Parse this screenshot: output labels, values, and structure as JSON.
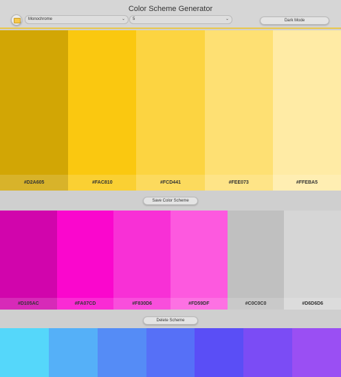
{
  "header": {
    "title": "Color Scheme Generator",
    "scheme_type": "Monochrome",
    "color_count": "5",
    "dark_mode_label": "Dark Mode"
  },
  "actions": {
    "save_label": "Save Color Scheme",
    "delete_label": "Delete Scheme"
  },
  "current_palette": [
    {
      "hex": "#D2A605"
    },
    {
      "hex": "#FAC810"
    },
    {
      "hex": "#FCD441"
    },
    {
      "hex": "#FEE073"
    },
    {
      "hex": "#FFEBA5"
    }
  ],
  "saved_palette_1": [
    {
      "hex": "#D105AC"
    },
    {
      "hex": "#FA07CD"
    },
    {
      "hex": "#F830D6"
    },
    {
      "hex": "#FD59DF"
    },
    {
      "hex": "#C0C0C0"
    },
    {
      "hex": "#D6D6D6"
    }
  ],
  "saved_palette_2": [
    {
      "color": "#55D7FA"
    },
    {
      "color": "#55B0F8"
    },
    {
      "color": "#558CF6"
    },
    {
      "color": "#5670F7"
    },
    {
      "color": "#5A4EF6"
    },
    {
      "color": "#7B4CF5"
    },
    {
      "color": "#9A4FF3"
    }
  ],
  "colors": {
    "header_accent": "#E9C74A",
    "background": "#CFCFCF"
  },
  "icons": {
    "palette_button": "color-swatch-icon",
    "dropdown": "chevron-down-icon"
  }
}
